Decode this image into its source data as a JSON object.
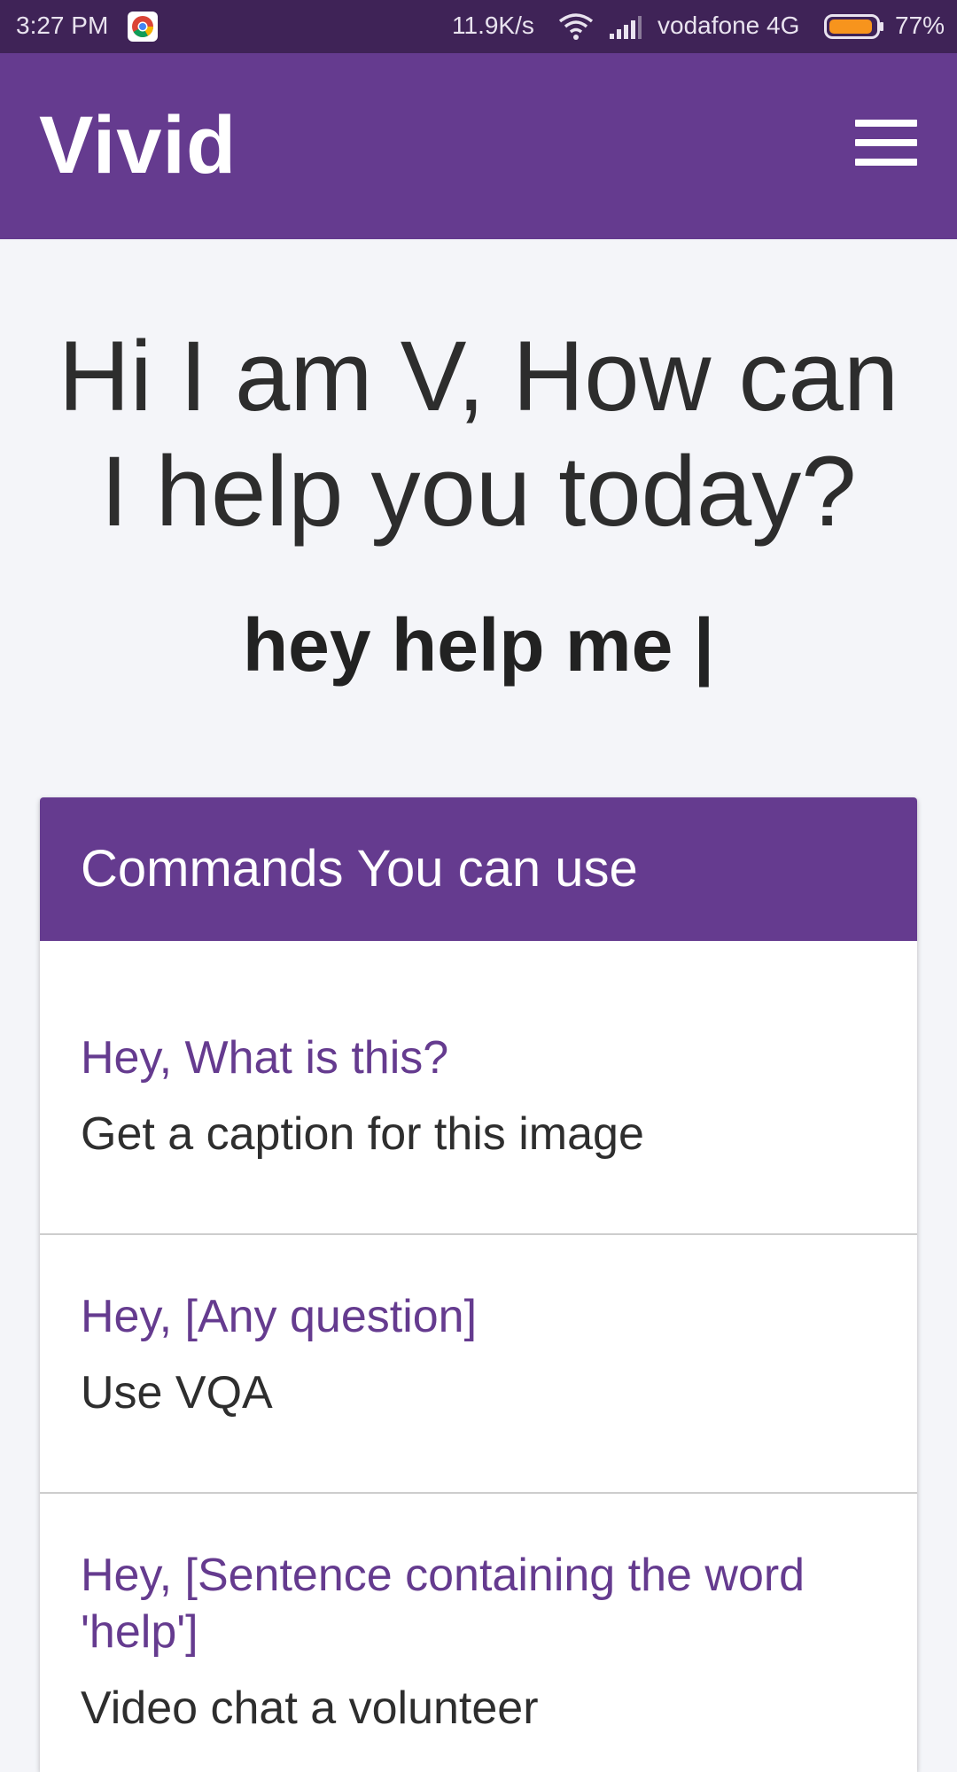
{
  "status_bar": {
    "time": "3:27 PM",
    "speed": "11.9K/s",
    "carrier": "vodafone 4G",
    "battery": "77%"
  },
  "app": {
    "title": "Vivid"
  },
  "greeting": "Hi I am V, How can I help you today?",
  "user_query": "hey help me |",
  "commands": {
    "header": "Commands You can use",
    "items": [
      {
        "phrase": "Hey, What is this?",
        "description": "Get a caption for this image"
      },
      {
        "phrase": "Hey, [Any question]",
        "description": "Use VQA"
      },
      {
        "phrase": "Hey, [Sentence containing the word 'help']",
        "description": "Video chat a volunteer"
      }
    ]
  },
  "colors": {
    "brand": "#653b8f",
    "status_bar": "#3f2357",
    "background": "#f4f5f9"
  }
}
